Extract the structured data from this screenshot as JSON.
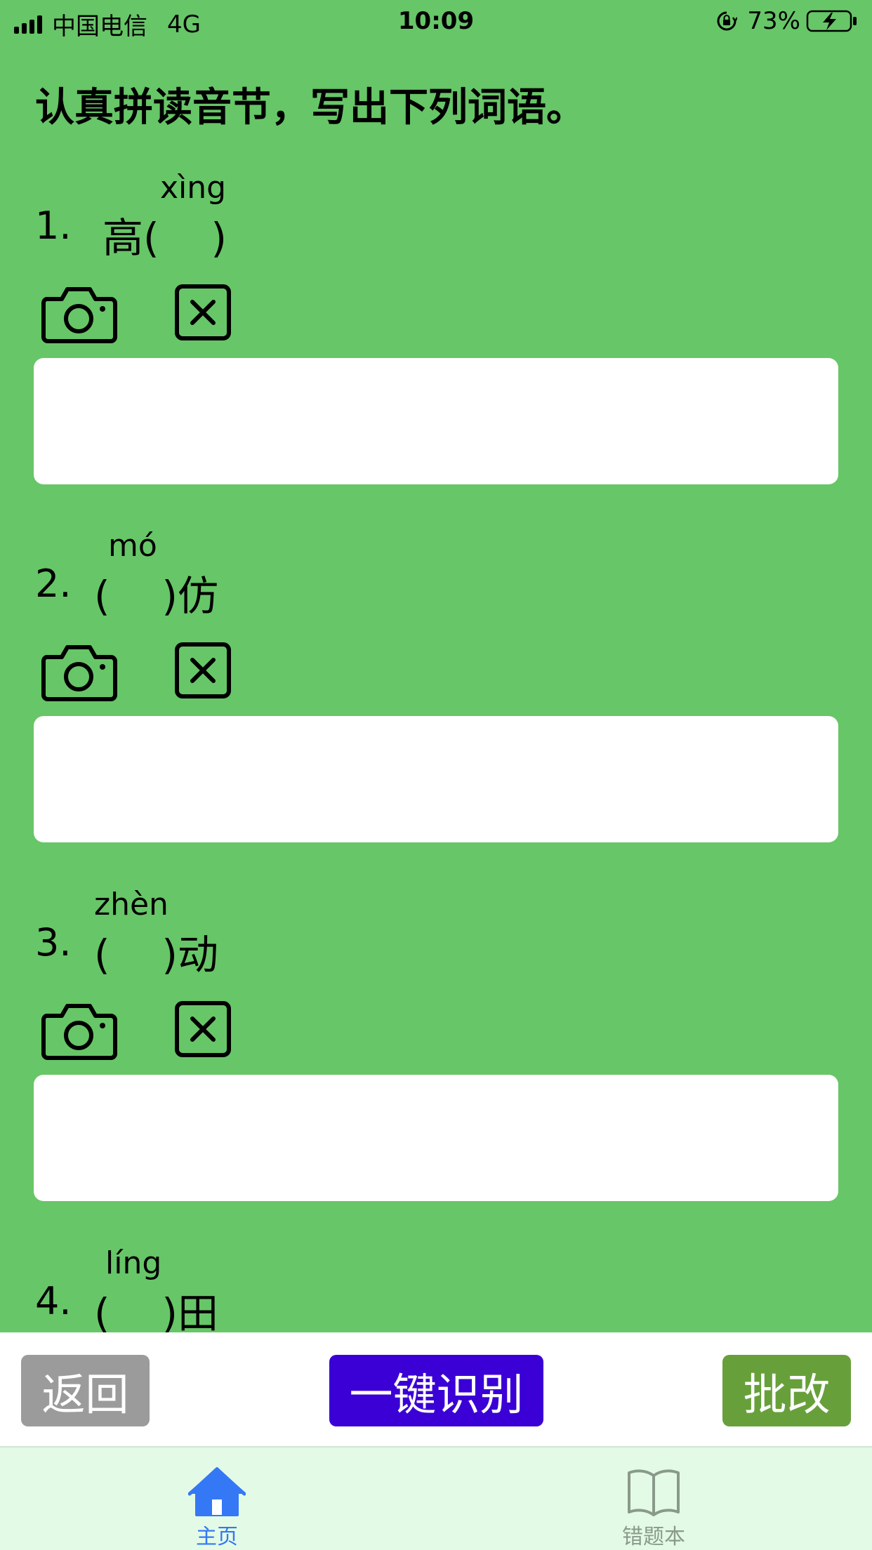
{
  "status_bar": {
    "carrier": "中国电信",
    "network": "4G",
    "time": "10:09",
    "battery_percent": "73%"
  },
  "page": {
    "title": "认真拼读音节，写出下列词语。"
  },
  "questions": [
    {
      "number": "1.",
      "pinyin": "xìng",
      "word": "高(    )",
      "answer_value": ""
    },
    {
      "number": "2.",
      "pinyin": "mó",
      "word": "(    )仿",
      "answer_value": ""
    },
    {
      "number": "3.",
      "pinyin": "zhèn",
      "word": "(    )动",
      "answer_value": ""
    },
    {
      "number": "4.",
      "pinyin": "líng",
      "word": "(    )田",
      "answer_value": ""
    }
  ],
  "action_bar": {
    "back_label": "返回",
    "recognize_label": "一键识别",
    "grade_label": "批改"
  },
  "tab_bar": {
    "home_label": "主页",
    "mistakes_label": "错题本"
  },
  "colors": {
    "background": "#67c667",
    "recognize_button": "#3a00d6",
    "grade_button": "#67a03b",
    "back_button": "#9b9b9b",
    "tab_active": "#3478f6"
  }
}
